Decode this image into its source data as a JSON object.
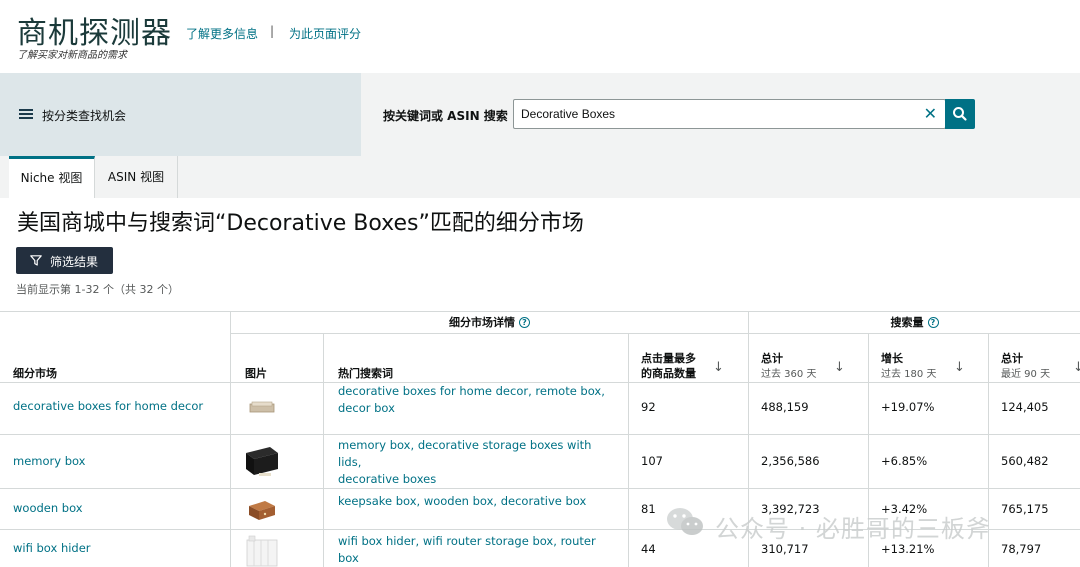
{
  "header": {
    "title": "商机探测器",
    "subtitle": "了解买家对新商品的需求",
    "learn_more": "了解更多信息",
    "separator": "|",
    "rate_page": "为此页面评分"
  },
  "search": {
    "category_label": "按分类查找机会",
    "label": "按关键词或 ASIN 搜索",
    "value": "Decorative Boxes",
    "clear": "✕"
  },
  "tabs": [
    {
      "label": "Niche 视图",
      "active": true
    },
    {
      "label": "ASIN 视图",
      "active": false
    }
  ],
  "main": {
    "title": "美国商城中与搜索词“Decorative Boxes”匹配的细分市场",
    "filter_button": "筛选结果",
    "result_count": "当前显示第 1-32 个（共 32 个）"
  },
  "table": {
    "groups": {
      "niche_details": "细分市场详情",
      "search_volume": "搜索量",
      "help": "?"
    },
    "columns": {
      "niche": "细分市场",
      "image": "图片",
      "top_terms": "热门搜索词",
      "clicked_1": "点击量最多",
      "clicked_2": "的商品数量",
      "total": "总计",
      "total_sub": "过去 360 天",
      "growth": "增长",
      "growth_sub": "过去 180 天",
      "total90": "总计",
      "total90_sub": "最近 90 天",
      "sort": "↓"
    },
    "rows": [
      {
        "niche": "decorative boxes for home decor",
        "terms": [
          "decorative boxes for home decor",
          "remote box",
          "decor box"
        ],
        "clicked": "92",
        "total": "488,159",
        "growth": "+19.07%",
        "total90": "124,405"
      },
      {
        "niche": "memory box",
        "terms": [
          "memory box",
          "decorative storage boxes with lids",
          "decorative boxes"
        ],
        "clicked": "107",
        "total": "2,356,586",
        "growth": "+6.85%",
        "total90": "560,482"
      },
      {
        "niche": "wooden box",
        "terms": [
          "keepsake box",
          "wooden box",
          "decorative box"
        ],
        "clicked": "81",
        "total": "3,392,723",
        "growth": "+3.42%",
        "total90": "765,175"
      },
      {
        "niche": "wifi box hider",
        "terms": [
          "wifi box hider",
          "wifi router storage box",
          "router box"
        ],
        "clicked": "44",
        "total": "310,717",
        "growth": "+13.21%",
        "total90": "78,797"
      }
    ]
  },
  "watermark": "公众号 · 必胜哥的三板斧",
  "colors": {
    "accent": "#007185",
    "dark_button": "#232f3e",
    "band_left": "#dde6e9",
    "band_right": "#f2f3f3"
  }
}
